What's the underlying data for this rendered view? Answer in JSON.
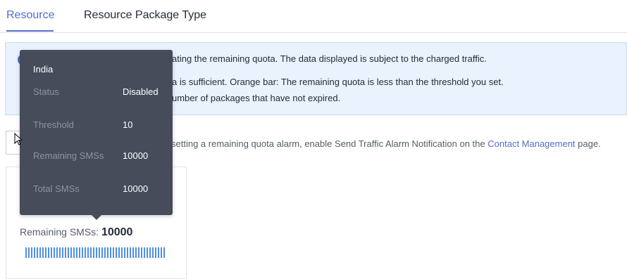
{
  "tabs": [
    {
      "label": "Resource",
      "active": true
    },
    {
      "label": "Resource Package Type",
      "active": false
    }
  ],
  "banner": {
    "line1": "ating the remaining quota. The data displayed is subject to the charged traffic.",
    "line2": "a is sufficient. Orange bar: The remaining quota is less than the threshold you set.",
    "line3": "umber of packages that have not expired."
  },
  "alarm": {
    "text_before": "setting a remaining quota alarm, enable Send Traffic Alarm Notification on the ",
    "link": "Contact Management",
    "text_after": " page."
  },
  "card": {
    "remaining_label": "Remaining SMSs:",
    "remaining_value": "10000",
    "progress_fraction": 1.0,
    "progress_color": "#4f8ee6"
  },
  "tooltip": {
    "title": "India",
    "rows": [
      {
        "label": "Status",
        "value": "Disabled"
      },
      {
        "label": "Threshold",
        "value": "10"
      },
      {
        "label": "Remaining SMSs",
        "value": "10000"
      },
      {
        "label": "Total SMSs",
        "value": "10000"
      }
    ]
  },
  "colors": {
    "accent": "#526ecc",
    "tooltip_bg": "#474c5a",
    "banner_bg": "#e9f2fd"
  }
}
